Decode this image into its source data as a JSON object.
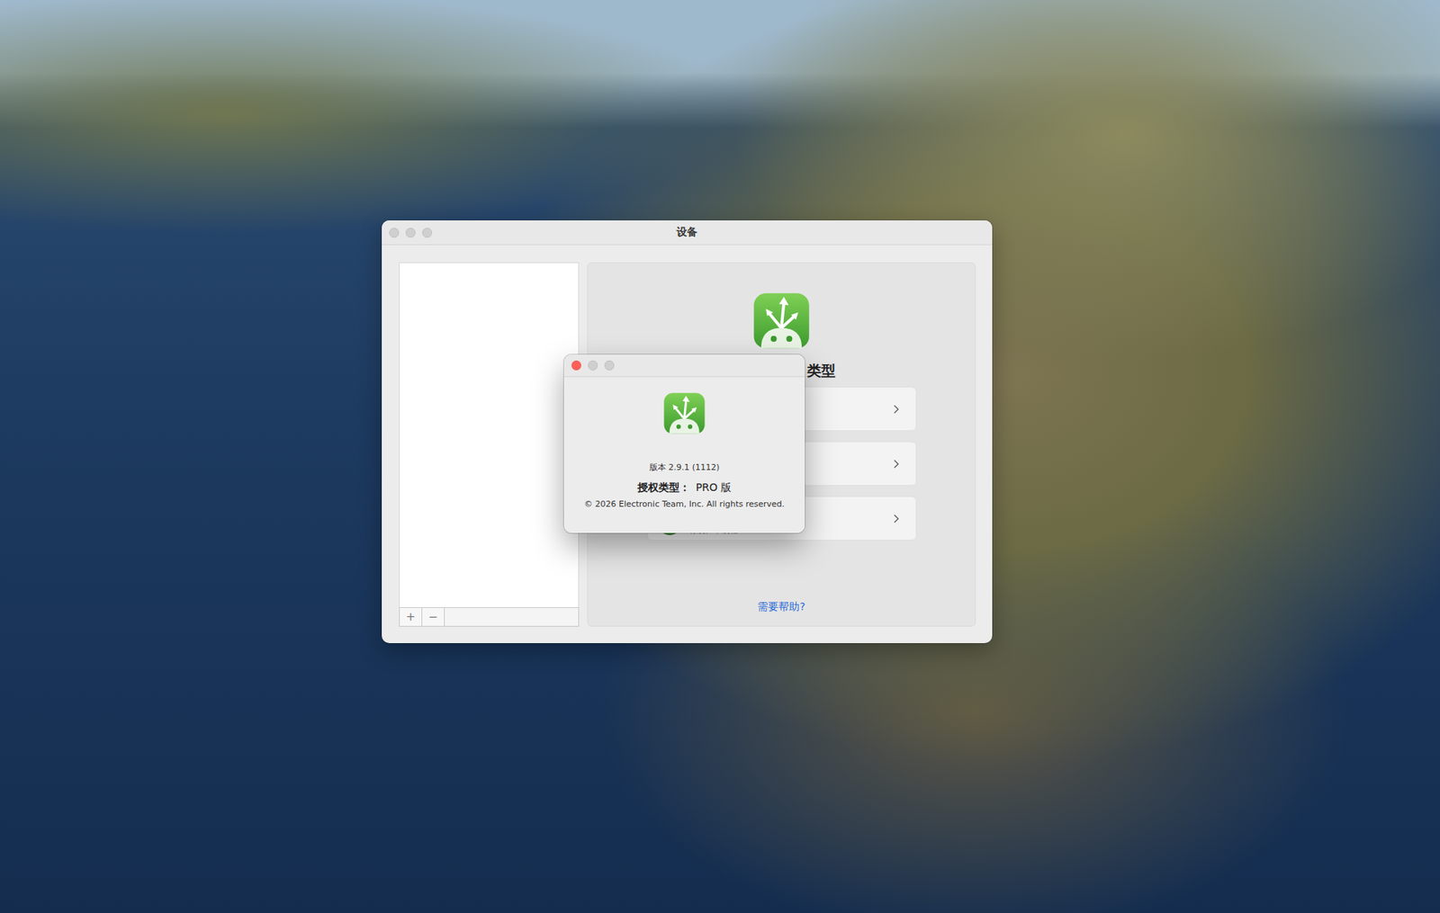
{
  "main_window": {
    "title": "设备",
    "traffic_lights": [
      {
        "active": false
      },
      {
        "active": false
      },
      {
        "active": false
      }
    ],
    "sidebar": {
      "buttons": [
        "+",
        "−"
      ]
    },
    "chooser": {
      "heading": "类型",
      "options": [
        {
          "kind": "plain"
        },
        {
          "kind": "plain"
        },
        {
          "kind": "badge",
          "badge": "MTP",
          "subtitle": "有线、单线程"
        }
      ],
      "help_link": "需要帮助?"
    }
  },
  "about_dialog": {
    "traffic_lights": [
      {
        "active": true
      },
      {
        "active": false
      },
      {
        "active": false
      }
    ],
    "version": "版本 2.9.1 (1112)",
    "license_label": "授权类型：",
    "license_value": "PRO 版",
    "copyright": "© 2026 Electronic Team, Inc. All rights reserved."
  }
}
